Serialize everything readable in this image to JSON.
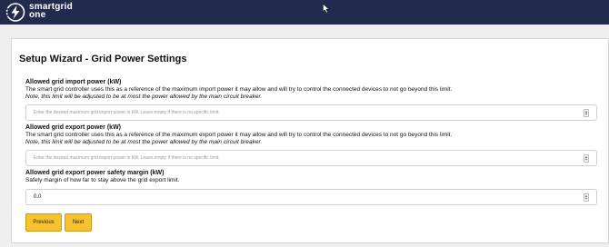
{
  "brand": {
    "line1": "smartgrid",
    "line2": "one"
  },
  "wizard": {
    "title": "Setup Wizard - Grid Power Settings",
    "import": {
      "label": "Allowed grid import power (kW)",
      "help": "The smart grid controller uses this as a reference of the maximum import power it may allow and will try to control the connected devices to not go beyond this limit.",
      "note": "Note, this limit will be adjusted to be at most the power allowed by the main circuit breaker.",
      "placeholder": "Enter the desired maximum grid import power in kW. Leave empty if there is no specific limit."
    },
    "export": {
      "label": "Allowed grid export power (kW)",
      "help": "The smart grid controller uses this as a reference of the maximum export power it may allow and will try to control the connected devices to not go beyond this limit.",
      "note": "Note, this limit will be adjusted to be at most the power allowed by the main circuit breaker.",
      "placeholder": "Enter the desired maximum grid export power in kW. Leave empty if there is no specific limit."
    },
    "margin": {
      "label": "Allowed grid export power safety margin (kW)",
      "help": "Safety margin of how far to stay above the grid export limit.",
      "value": "0.0"
    },
    "buttons": {
      "previous": "Previous",
      "next": "Next"
    }
  },
  "colors": {
    "topbar": "#222a4d",
    "button": "#f6c232",
    "background": "#eeeeee"
  },
  "icons": {
    "logo": "lightning-bolt-icon",
    "cursor": "mouse-pointer-icon"
  }
}
